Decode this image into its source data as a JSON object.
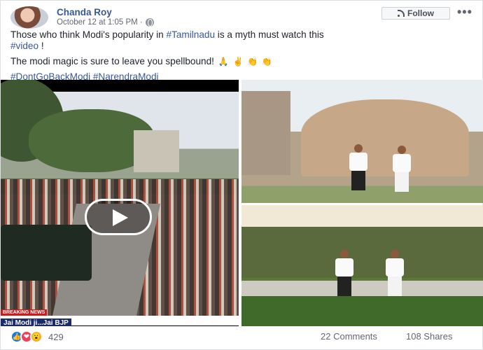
{
  "post": {
    "author": "Chanda Roy",
    "timestamp": "October 12 at 1:05 PM · ",
    "follow_label": "Follow",
    "more_label": "•••",
    "line1_prefix": "Those who think Modi's popularity in ",
    "line1_hashtag": "#Tamilnadu",
    "line1_suffix": " is a myth must watch this",
    "line2_hashtag": "#video",
    "line2_suffix": " !",
    "line3_text": "The modi magic is sure to leave you spellbound! ",
    "emojis": [
      "🙏",
      "✌",
      "👏",
      "👏"
    ],
    "hashtag_a": "#DontGoBackModi",
    "hashtag_b": "#NarendraModi"
  },
  "video": {
    "breaking_label": "BREAKING NEWS",
    "ticker_text": "Jai Modi ji...Jai BJP"
  },
  "footer": {
    "reaction_icons": [
      "like-icon",
      "love-icon",
      "wow-icon"
    ],
    "reaction_count": "429",
    "comments": "22 Comments",
    "shares": "108 Shares"
  },
  "colors": {
    "link": "#365899",
    "like": "#1877f2",
    "love": "#f33e58",
    "wow": "#f7b125"
  }
}
